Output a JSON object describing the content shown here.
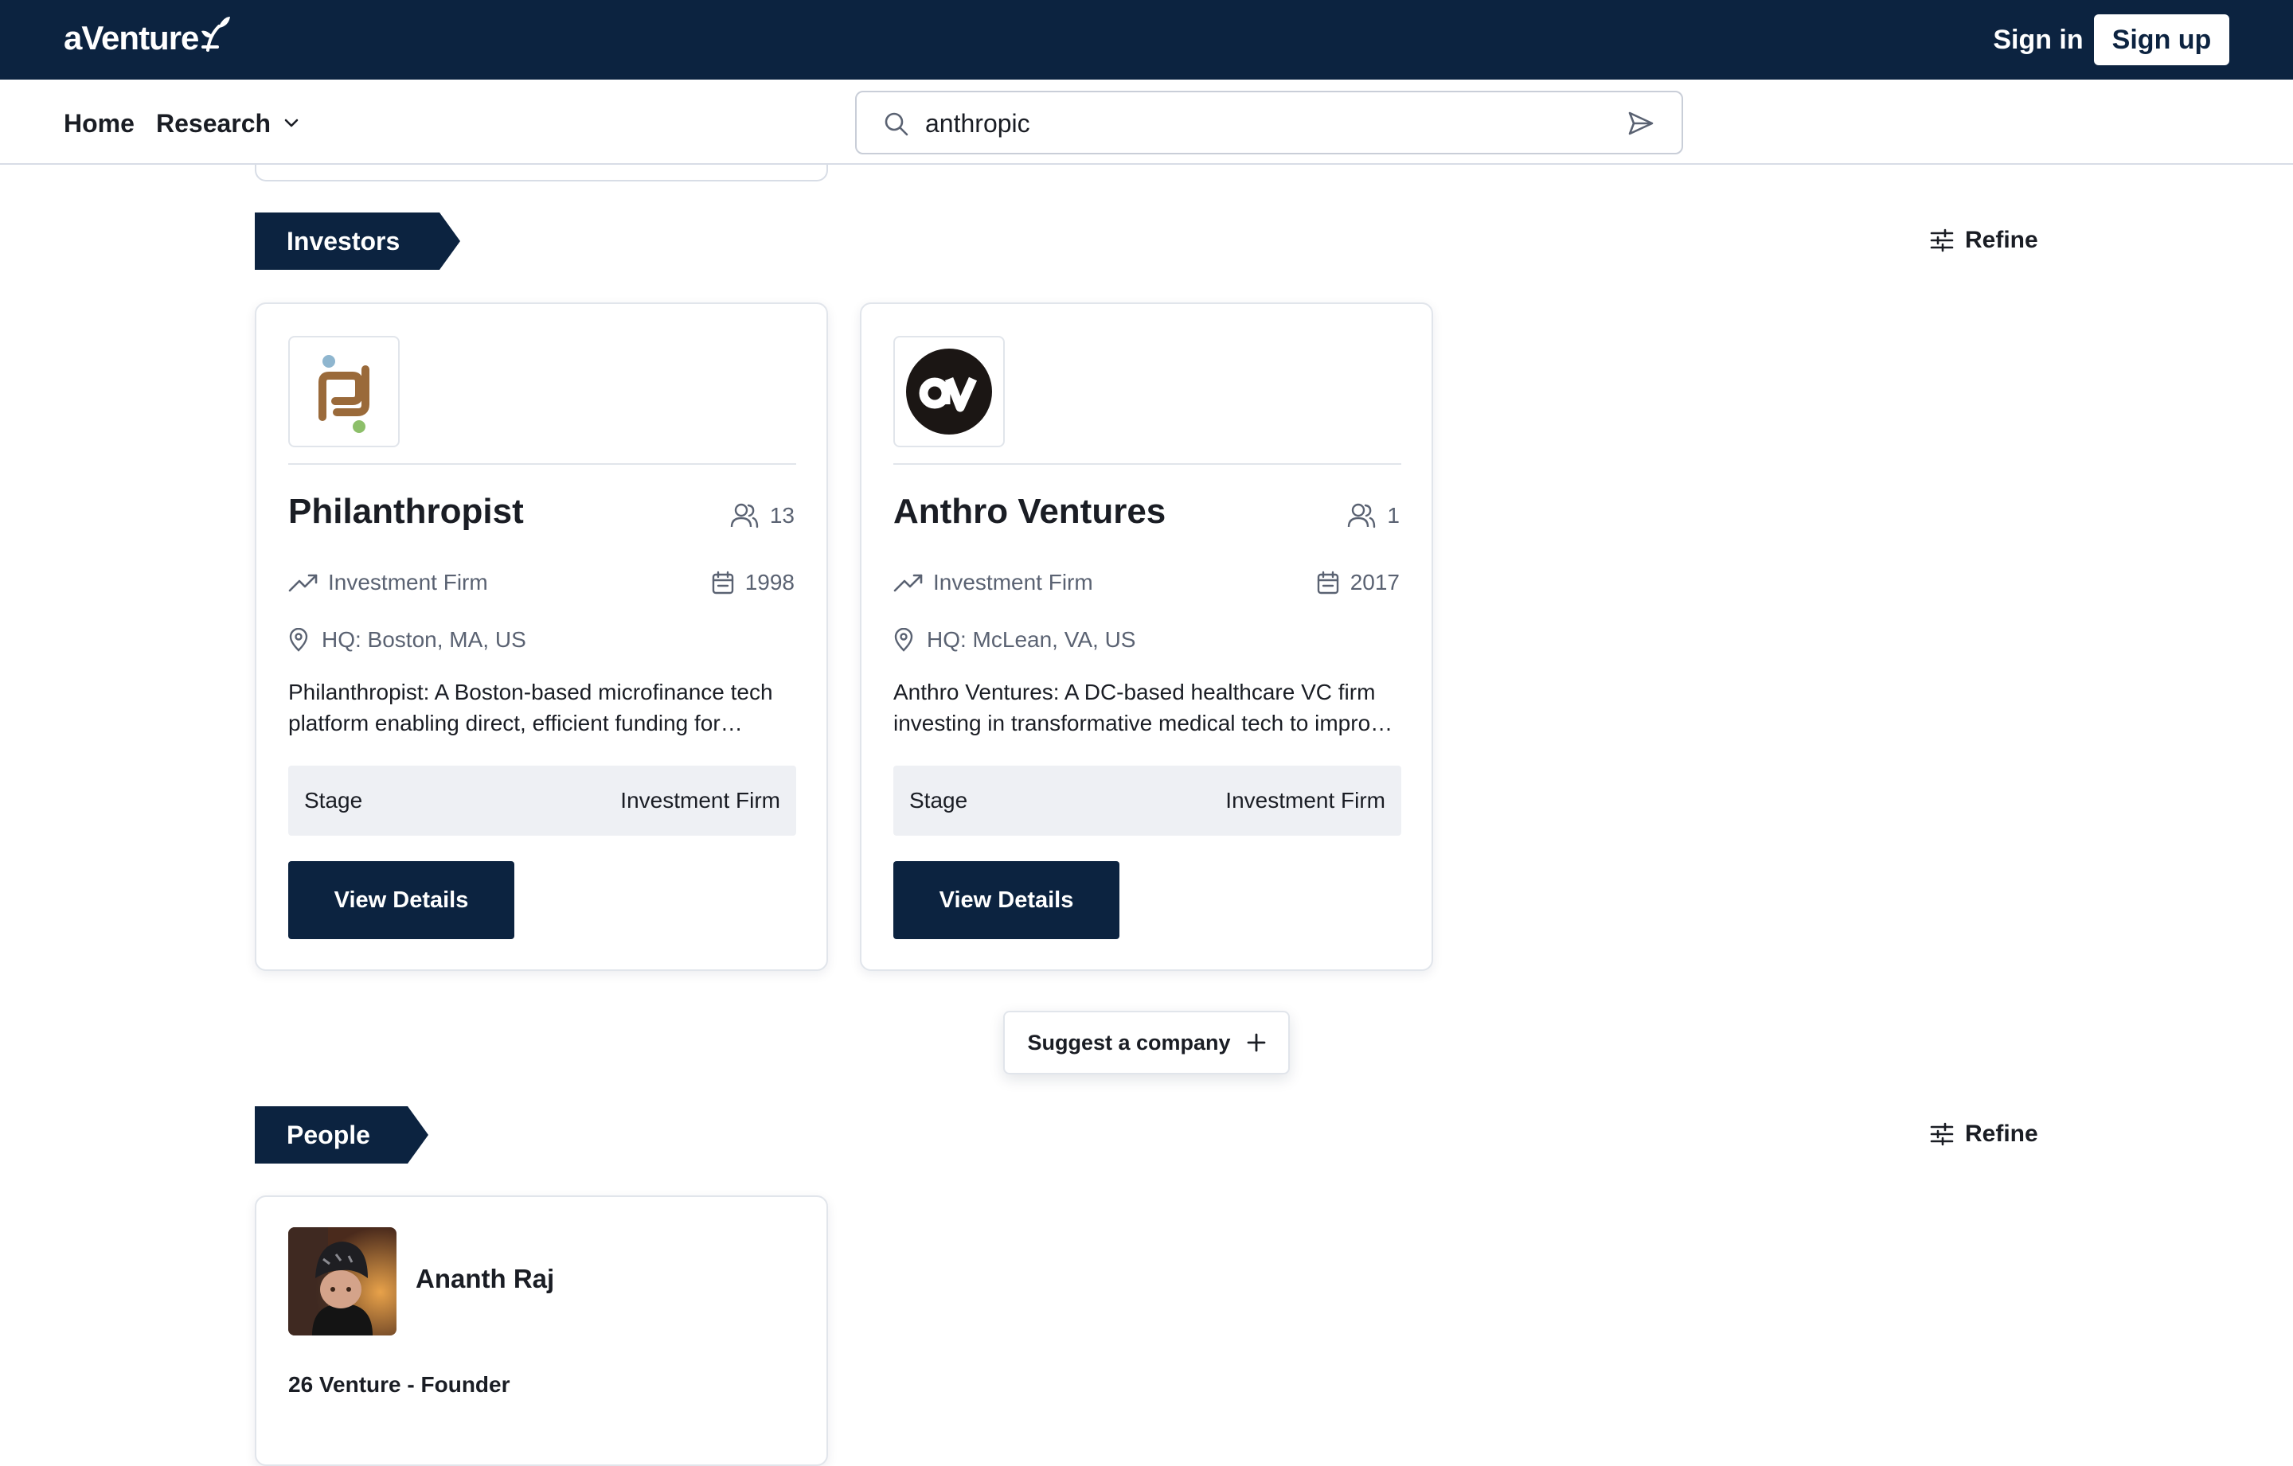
{
  "app": {
    "logo_text": "aVenture",
    "sign_in_label": "Sign in",
    "sign_up_label": "Sign up"
  },
  "nav": {
    "home_label": "Home",
    "research_label": "Research"
  },
  "search": {
    "value": "anthropic",
    "icon": "search-icon",
    "submit_icon": "send-icon"
  },
  "sections": {
    "investors": {
      "title": "Investors",
      "refine_label": "Refine"
    },
    "people": {
      "title": "People",
      "refine_label": "Refine"
    }
  },
  "investors": [
    {
      "name": "Philanthropist",
      "members": "13",
      "type": "Investment Firm",
      "year": "1998",
      "hq": "HQ: Boston, MA, US",
      "description": "Philanthropist: A Boston-based microfinance tech platform enabling direct, efficient funding for innovative ventures.",
      "stage_label": "Stage",
      "stage_value": "Investment Firm",
      "button_label": "View Details"
    },
    {
      "name": "Anthro Ventures",
      "members": "1",
      "type": "Investment Firm",
      "year": "2017",
      "hq": "HQ: McLean, VA, US",
      "description": "Anthro Ventures: A DC-based healthcare VC firm investing in transformative medical tech to improve patient outcomes.",
      "stage_label": "Stage",
      "stage_value": "Investment Firm",
      "button_label": "View Details"
    }
  ],
  "suggest": {
    "label": "Suggest a company"
  },
  "people": [
    {
      "name": "Ananth Raj",
      "role": "26 Venture - Founder"
    }
  ],
  "colors": {
    "navy": "#0c2340",
    "text": "#1a1d24",
    "muted": "#5a6272",
    "stage_bg": "#eef0f4",
    "border": "#e1e5eb"
  }
}
